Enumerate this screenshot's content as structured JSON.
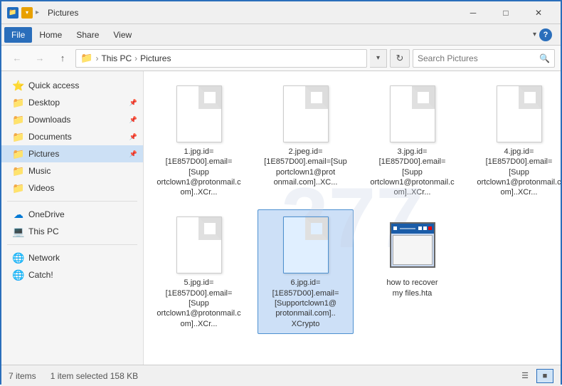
{
  "titleBar": {
    "title": "Pictures",
    "minimizeLabel": "─",
    "maximizeLabel": "□",
    "closeLabel": "✕"
  },
  "menuBar": {
    "items": [
      "File",
      "Home",
      "Share",
      "View"
    ]
  },
  "addressBar": {
    "backLabel": "←",
    "forwardLabel": "→",
    "upLabel": "↑",
    "pathParts": [
      "This PC",
      "Pictures"
    ],
    "searchPlaceholder": "Search Pictures",
    "refreshLabel": "↻"
  },
  "sidebar": {
    "quickAccessLabel": "Quick access",
    "items": [
      {
        "name": "Desktop",
        "icon": "📁",
        "pinned": true
      },
      {
        "name": "Downloads",
        "icon": "📁",
        "pinned": true
      },
      {
        "name": "Documents",
        "icon": "📁",
        "pinned": true
      },
      {
        "name": "Pictures",
        "icon": "📁",
        "pinned": true,
        "active": true
      },
      {
        "name": "Music",
        "icon": "📁"
      },
      {
        "name": "Videos",
        "icon": "📁"
      }
    ],
    "cloudItems": [
      {
        "name": "OneDrive",
        "icon": "☁"
      },
      {
        "name": "This PC",
        "icon": "💻"
      },
      {
        "name": "Network",
        "icon": "🌐"
      },
      {
        "name": "Catch!",
        "icon": "🌐"
      }
    ]
  },
  "files": [
    {
      "id": 1,
      "name": "1.jpg.id=[1E857D00].email=[Supportclown1@protonmail.com]..XCr...",
      "selected": false,
      "type": "document"
    },
    {
      "id": 2,
      "name": "2.jpeg.id=[1E857D00].email=[Supportclown1@protonmail.com]..XC...",
      "selected": false,
      "type": "document"
    },
    {
      "id": 3,
      "name": "3.jpg.id=[1E857D00].email=[Supportclown1@protonmail.com]..XCr...",
      "selected": false,
      "type": "document"
    },
    {
      "id": 4,
      "name": "4.jpg.id=[1E857D00].email=[Supportclown1@protonmail.com]..XCr...",
      "selected": false,
      "type": "document"
    },
    {
      "id": 5,
      "name": "5.jpg.id=[1E857D00].email=[Supportclown1@protonmail.com]..XCr...",
      "selected": false,
      "type": "document"
    },
    {
      "id": 6,
      "name": "6.jpg.id=\n[1E857D00].email=\n[Supportclown1@protonmail.com]..\nXCrypto",
      "selected": true,
      "type": "document"
    },
    {
      "id": 7,
      "name": "how to recover\nmy files.hta",
      "selected": false,
      "type": "hta"
    }
  ],
  "statusBar": {
    "itemCount": "7 items",
    "selectedInfo": "1 item selected  158 KB"
  }
}
